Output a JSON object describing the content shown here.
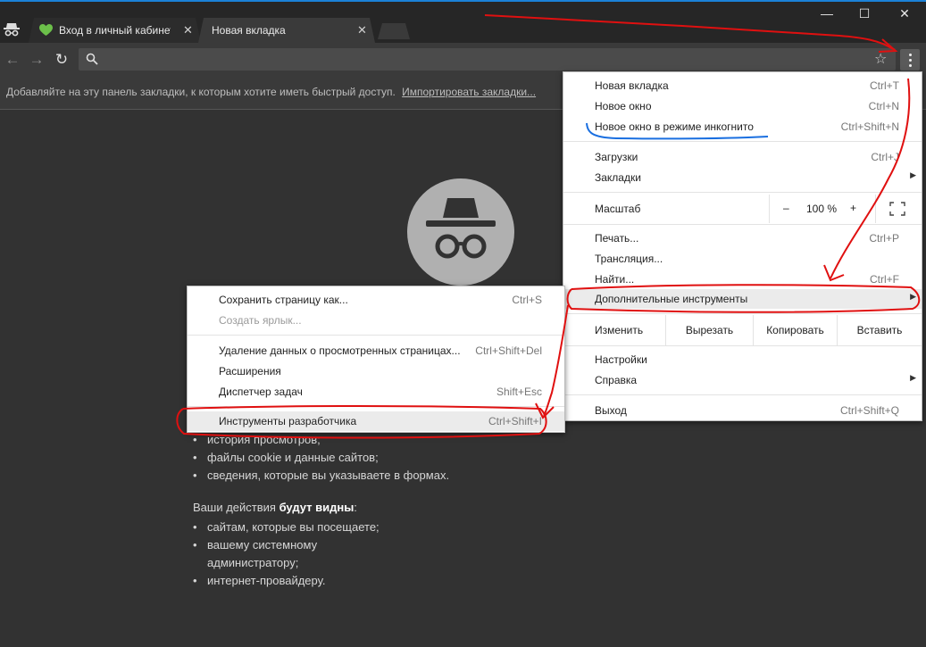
{
  "tabs": [
    {
      "title": "Вход в личный кабинет",
      "close": "✕"
    },
    {
      "title": "Новая вкладка",
      "close": "✕"
    }
  ],
  "window_controls": {
    "minimize": "—",
    "maximize": "☐",
    "close": "✕"
  },
  "bookmarks_bar": {
    "text": "Добавляйте на эту панель закладки, к которым хотите иметь быстрый доступ.",
    "import_link": "Импортировать закладки..."
  },
  "main_menu": {
    "new_tab": {
      "label": "Новая вкладка",
      "shortcut": "Ctrl+T"
    },
    "new_window": {
      "label": "Новое окно",
      "shortcut": "Ctrl+N"
    },
    "incognito": {
      "label": "Новое окно в режиме инкогнито",
      "shortcut": "Ctrl+Shift+N"
    },
    "downloads": {
      "label": "Загрузки",
      "shortcut": "Ctrl+J"
    },
    "bookmarks": {
      "label": "Закладки"
    },
    "zoom": {
      "label": "Масштаб",
      "minus": "–",
      "value": "100 %",
      "plus": "+"
    },
    "print": {
      "label": "Печать...",
      "shortcut": "Ctrl+P"
    },
    "cast": {
      "label": "Трансляция..."
    },
    "find": {
      "label": "Найти...",
      "shortcut": "Ctrl+F"
    },
    "more_tools": {
      "label": "Дополнительные инструменты"
    },
    "edit": {
      "label": "Изменить",
      "cut": "Вырезать",
      "copy": "Копировать",
      "paste": "Вставить"
    },
    "settings": {
      "label": "Настройки"
    },
    "help": {
      "label": "Справка"
    },
    "exit": {
      "label": "Выход",
      "shortcut": "Ctrl+Shift+Q"
    }
  },
  "submenu": {
    "save_page": {
      "label": "Сохранить страницу как...",
      "shortcut": "Ctrl+S"
    },
    "create_shortcut": {
      "label": "Создать ярлык..."
    },
    "clear_data": {
      "label": "Удаление данных о просмотренных страницах...",
      "shortcut": "Ctrl+Shift+Del"
    },
    "extensions": {
      "label": "Расширения"
    },
    "task_manager": {
      "label": "Диспетчер задач",
      "shortcut": "Shift+Esc"
    },
    "dev_tools": {
      "label": "Инструменты разработчика",
      "shortcut": "Ctrl+Shift+I"
    }
  },
  "incognito_page": {
    "list1": [
      "история просмотров;",
      "файлы cookie и данные сайтов;",
      "сведения, которые вы указываете в формах."
    ],
    "para_start": "Ваши действия ",
    "para_bold": "будут видны",
    "para_end": ":",
    "list2": [
      "сайтам, которые вы посещаете;",
      "вашему системному администратору;",
      "интернет-провайдеру."
    ]
  },
  "colors": {
    "annotation_red": "#e01010",
    "annotation_blue": "#1a6fe0",
    "accent_blue": "#1b82d8"
  }
}
